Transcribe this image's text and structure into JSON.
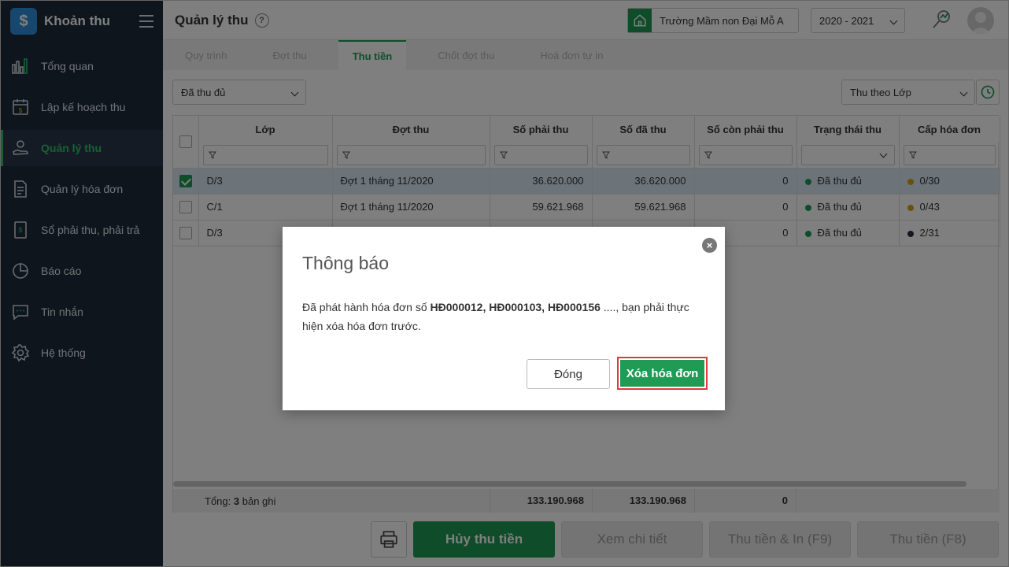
{
  "brand": {
    "name": "Khoản thu",
    "logo_glyph": "$"
  },
  "sidebar": {
    "items": [
      {
        "label": "Tổng quan",
        "icon": "bar-chart-icon"
      },
      {
        "label": "Lập kế hoạch thu",
        "icon": "calendar-money-icon"
      },
      {
        "label": "Quản lý thu",
        "icon": "hand-coin-icon"
      },
      {
        "label": "Quản lý hóa đơn",
        "icon": "document-icon"
      },
      {
        "label": "Sổ phải thu, phải trả",
        "icon": "ledger-icon"
      },
      {
        "label": "Báo cáo",
        "icon": "pie-chart-icon"
      },
      {
        "label": "Tin nhắn",
        "icon": "chat-icon"
      },
      {
        "label": "Hệ thống",
        "icon": "gear-icon"
      }
    ],
    "active_index": 2
  },
  "header": {
    "title": "Quản lý thu",
    "help_glyph": "?",
    "school": "Trường Mầm non Đại Mỗ A",
    "year": "2020 - 2021"
  },
  "tabs": [
    {
      "label": "Quy trình"
    },
    {
      "label": "Đợt thu"
    },
    {
      "label": "Thu tiền"
    },
    {
      "label": "Chốt đợt thu"
    },
    {
      "label": "Hoá đơn tự in"
    }
  ],
  "filters": {
    "status": "Đã thu đủ",
    "view_mode": "Thu theo Lớp"
  },
  "table": {
    "columns": [
      "Lớp",
      "Đợt thu",
      "Số phải thu",
      "Số đã thu",
      "Số còn phải thu",
      "Trạng thái thu",
      "Cấp hóa đơn"
    ],
    "rows": [
      {
        "lop": "D/3",
        "dot_thu": "Đợt 1 tháng 11/2020",
        "phai_thu": "36.620.000",
        "da_thu": "36.620.000",
        "con_phai_thu": "0",
        "trang_thai": "Đã thu đủ",
        "hoa_don": "0/30",
        "checked": true,
        "hd_color": "#d4a017"
      },
      {
        "lop": "C/1",
        "dot_thu": "Đợt 1 tháng 11/2020",
        "phai_thu": "59.621.968",
        "da_thu": "59.621.968",
        "con_phai_thu": "0",
        "trang_thai": "Đã thu đủ",
        "hoa_don": "0/43",
        "checked": false,
        "hd_color": "#d4a017"
      },
      {
        "lop": "D/3",
        "dot_thu": "",
        "phai_thu": "",
        "da_thu": "",
        "con_phai_thu": "0",
        "trang_thai": "Đã thu đủ",
        "hoa_don": "2/31",
        "checked": false,
        "hd_color": "#2c2c4a"
      }
    ],
    "footer": {
      "label_prefix": "Tổng:",
      "count": "3",
      "label_suffix": "bản ghi",
      "phai_thu": "133.190.968",
      "da_thu": "133.190.968",
      "con_phai_thu": "0"
    }
  },
  "bottom_buttons": {
    "cancel_collect": "Hủy thu tiền",
    "view_detail": "Xem chi tiết",
    "collect_print": "Thu tiền & In (F9)",
    "collect": "Thu tiền (F8)"
  },
  "modal": {
    "title": "Thông báo",
    "message_prefix": "Đã phát hành hóa đơn số",
    "invoice_numbers": "HĐ000012, HĐ000103, HĐ000156",
    "message_suffix": "...., bạn phải thực hiện xóa hóa đơn trước.",
    "close_glyph": "×",
    "close_button": "Đóng",
    "delete_button": "Xóa hóa đơn"
  },
  "colors": {
    "primary_green": "#1f9b55",
    "sidebar_bg": "#1f2b3a",
    "active_nav": "#2fc26b",
    "highlight_border": "#e0393e",
    "status_dot": "#1f9b55"
  }
}
